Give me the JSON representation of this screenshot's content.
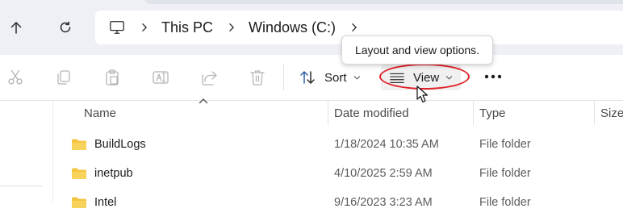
{
  "address": {
    "crumbs": [
      "This PC",
      "Windows (C:)"
    ]
  },
  "toolbar": {
    "sort_label": "Sort",
    "view_label": "View",
    "icons": [
      "cut-icon",
      "copy-icon",
      "paste-icon",
      "rename-icon",
      "share-icon",
      "delete-icon",
      "sort-icon",
      "view-lines-icon",
      "more-options-icon"
    ]
  },
  "tooltip": {
    "text": "Layout and view options."
  },
  "columns": {
    "name": "Name",
    "date": "Date modified",
    "type": "Type",
    "size": "Size"
  },
  "files": [
    {
      "name": "BuildLogs",
      "date": "1/18/2024 10:35 AM",
      "type": "File folder"
    },
    {
      "name": "inetpub",
      "date": "4/10/2025 2:59 AM",
      "type": "File folder"
    },
    {
      "name": "Intel",
      "date": "9/16/2023 3:23 AM",
      "type": "File folder"
    }
  ],
  "colors": {
    "folder": "#f4c542",
    "highlight": "#e0202a",
    "topbar": "#eef0f5"
  }
}
